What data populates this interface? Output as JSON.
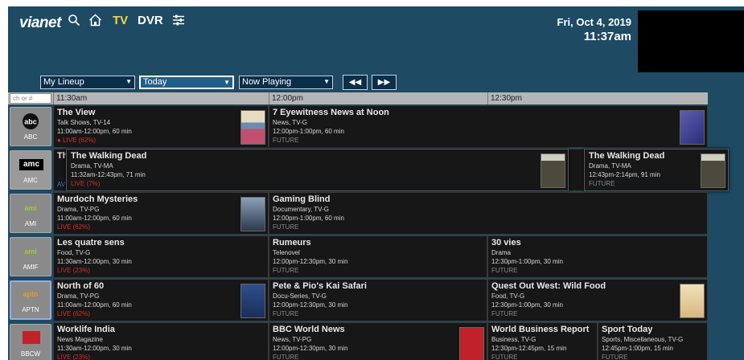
{
  "header": {
    "logo": "vianet",
    "tv_label": "TV",
    "dvr_label": "DVR",
    "date": "Fri, Oct 4, 2019",
    "time": "11:37am"
  },
  "icons": {
    "search": "search-icon",
    "home": "home-icon",
    "settings": "sliders-icon",
    "prev": "rewind-icon",
    "next": "fast-forward-icon"
  },
  "controls": {
    "lineup": "My Lineup",
    "day": "Today",
    "showing": "Now Playing"
  },
  "timebar": {
    "search_placeholder": "ch or #",
    "slots": [
      "11:30am",
      "12:00pm",
      "12:30pm"
    ]
  },
  "channels": [
    {
      "name": "ABC",
      "logo": "abc",
      "programs": [
        {
          "title": "The View",
          "genre": "Talk Shows, TV-14",
          "time": "11:00am-12:00pm, 60 min",
          "status": "LIVE (62%)"
        },
        {
          "title": "7 Eyewitness News at Noon",
          "genre": "News, TV-G",
          "time": "12:00pm-1:00pm, 60 min",
          "status": "FUTURE"
        }
      ]
    },
    {
      "name": "AMC",
      "logo": "amc",
      "programs": [
        {
          "title": "The Walking Dead",
          "genre": "Drama, TV-MA",
          "time": "11:32am-12:43pm, 71 min",
          "status": "LIVE (7%)",
          "partial_title": "Th",
          "partial_status": "AV"
        },
        {
          "title": "The Walking Dead",
          "genre": "Drama, TV-MA",
          "time": "12:43pm-2:14pm, 91 min",
          "status": "FUTURE"
        }
      ]
    },
    {
      "name": "AMI",
      "logo": "ami",
      "programs": [
        {
          "title": "Murdoch Mysteries",
          "genre": "Drama, TV-PG",
          "time": "11:00am-12:00pm, 60 min",
          "status": "LIVE (62%)"
        },
        {
          "title": "Gaming Blind",
          "genre": "Documentary, TV-G",
          "time": "12:00pm-1:00pm, 60 min",
          "status": "FUTURE"
        }
      ]
    },
    {
      "name": "AMIF",
      "logo": "ami",
      "programs": [
        {
          "title": "Les quatre sens",
          "genre": "Food, TV-G",
          "time": "11:30am-12:00pm, 30 min",
          "status": "LIVE (23%)"
        },
        {
          "title": "Rumeurs",
          "genre": "Telenovel",
          "time": "12:00pm-12:30pm, 30 min",
          "status": "FUTURE"
        },
        {
          "title": "30 vies",
          "genre": "Drama",
          "time": "12:30pm-1:00pm, 30 min",
          "status": "FUTURE"
        }
      ]
    },
    {
      "name": "APTN",
      "logo": "aptn",
      "programs": [
        {
          "title": "North of 60",
          "genre": "Drama, TV-PG",
          "time": "11:00am-12:00pm, 60 min",
          "status": "LIVE (62%)"
        },
        {
          "title": "Pete & Pio's Kai Safari",
          "genre": "Docu-Series, TV-G",
          "time": "12:00pm-12:30pm, 30 min",
          "status": "FUTURE"
        },
        {
          "title": "Quest Out West: Wild Food",
          "genre": "Food, TV-G",
          "time": "12:30pm-1:00pm, 30 min",
          "status": "FUTURE"
        }
      ]
    },
    {
      "name": "BBCW",
      "logo": "bbc",
      "programs": [
        {
          "title": "Worklife India",
          "genre": "News Magazine",
          "time": "11:30am-12:00pm, 30 min",
          "status": "LIVE (23%)"
        },
        {
          "title": "BBC World News",
          "genre": "News, TV-PG",
          "time": "12:00pm-12:30pm, 30 min",
          "status": "FUTURE"
        },
        {
          "title": "World Business Report",
          "genre": "Business, TV-G",
          "time": "12:30pm-12:45pm, 15 min",
          "status": "FUTURE"
        },
        {
          "title": "Sport Today",
          "genre": "Sports, Miscellaneous, TV-G",
          "time": "12:45pm-1:00pm, 15 min",
          "status": "FUTURE"
        }
      ]
    }
  ],
  "colors": {
    "background": "#1e4a63",
    "accent": "#f3d34a",
    "live": "#d23030",
    "future": "#8a8a8a"
  }
}
